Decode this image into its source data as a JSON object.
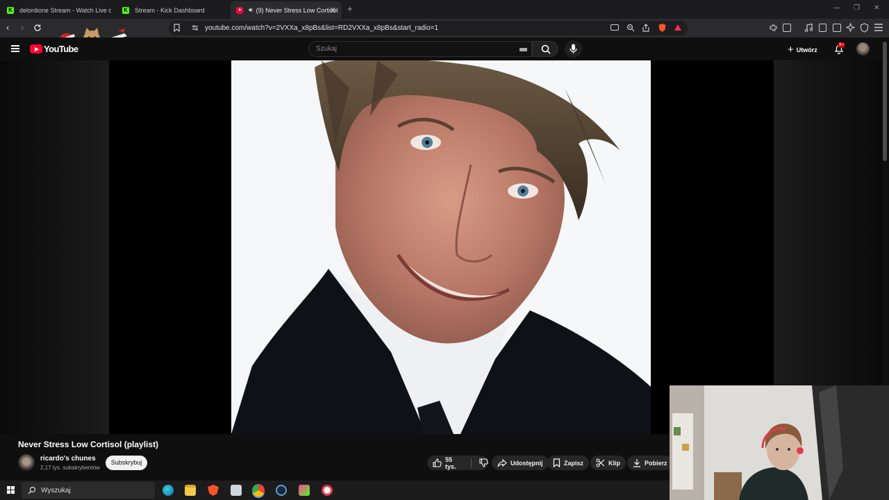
{
  "browser": {
    "tabs": [
      {
        "title": "delordione Stream - Watch Live o",
        "favicon": "kick",
        "active": false
      },
      {
        "title": "Stream - Kick Dashboard",
        "favicon": "kick",
        "active": false
      },
      {
        "title": "(9) Never Stress Low Cortisol",
        "favicon": "youtube",
        "active": true
      }
    ],
    "new_tab_label": "+",
    "url": "youtube.com/watch?v=2VXXa_x8pBs&list=RD2VXXa_x8pBs&start_radio=1"
  },
  "youtube": {
    "logo_text": "YouTube",
    "search_placeholder": "Szukaj",
    "create_label": "Utwórz",
    "notification_badge": "9+"
  },
  "video": {
    "title": "Never Stress Low Cortisol (playlist)",
    "channel_name": "ricardo's chunes",
    "channel_subs": "2,17 tys. subskrybentów",
    "subscribe_label": "Subskrybuj",
    "likes": "55 tys.",
    "actions": {
      "share": "Udostępnij",
      "save": "Zapisz",
      "clip": "Klip",
      "download": "Pobierz"
    }
  },
  "taskbar": {
    "search_label": "Wyszukaj"
  },
  "colors": {
    "brand": "#ff0033",
    "background": "#0f0f0f",
    "kick": "#53fc18"
  }
}
